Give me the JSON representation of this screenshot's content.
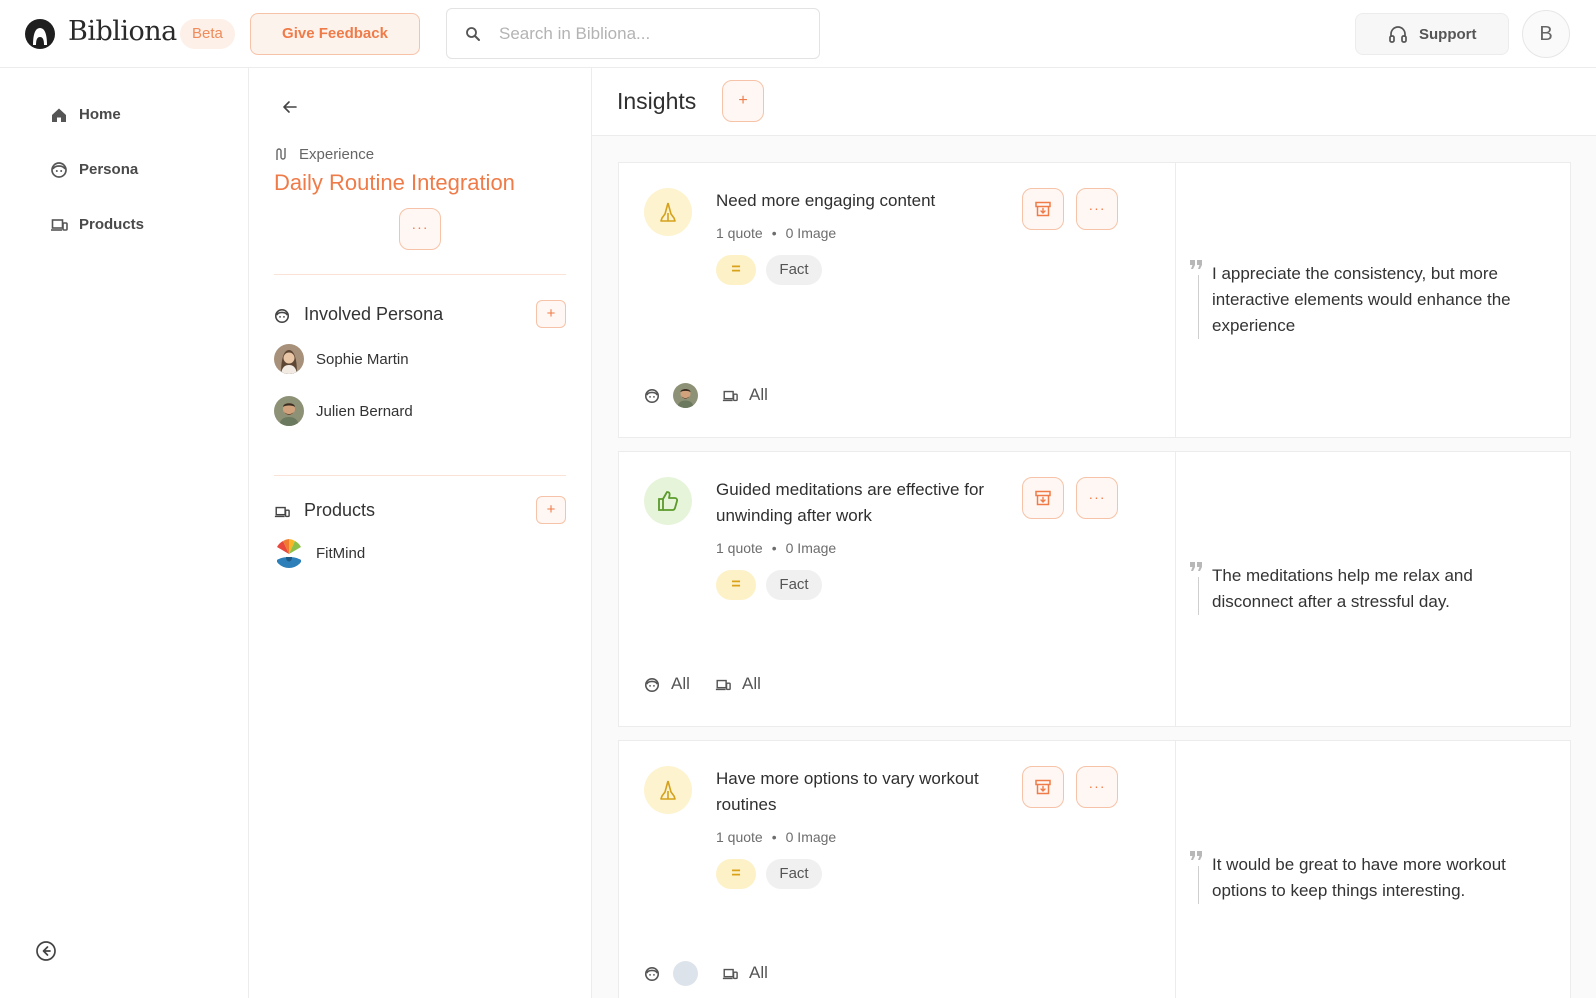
{
  "app": {
    "name": "Bibliona",
    "beta_label": "Beta",
    "feedback_label": "Give Feedback",
    "search_placeholder": "Search in Bibliona...",
    "support_label": "Support",
    "user_initial": "B"
  },
  "nav": {
    "items": [
      {
        "label": "Home",
        "icon": "home-icon"
      },
      {
        "label": "Persona",
        "icon": "persona-icon"
      },
      {
        "label": "Products",
        "icon": "devices-icon"
      }
    ]
  },
  "experience": {
    "type_label": "Experience",
    "title": "Daily Routine Integration",
    "more_label": "···",
    "involved_persona": {
      "heading": "Involved Persona",
      "add_label": "+",
      "people": [
        {
          "name": "Sophie Martin"
        },
        {
          "name": "Julien Bernard"
        }
      ]
    },
    "products": {
      "heading": "Products",
      "add_label": "+",
      "items": [
        {
          "name": "FitMind"
        }
      ]
    }
  },
  "insights": {
    "title": "Insights",
    "add_label": "+",
    "cards": [
      {
        "kind": "need",
        "kind_color": "#fdf3cf",
        "title": "Need more engaging content",
        "quotes": "1 quote",
        "images": "0 Image",
        "sentiment": "=",
        "tag": "Fact",
        "persona_text": "",
        "product_text": "All",
        "quote": "I appreciate the consistency, but more interactive elements would enhance the experience"
      },
      {
        "kind": "positive",
        "kind_color": "#e6f4da",
        "title": "Guided meditations are effective for unwinding after work",
        "quotes": "1 quote",
        "images": "0 Image",
        "sentiment": "=",
        "tag": "Fact",
        "persona_text": "All",
        "product_text": "All",
        "quote": "The meditations help me relax and disconnect after a stressful day."
      },
      {
        "kind": "need",
        "kind_color": "#fdf3cf",
        "title": "Have more options to vary workout routines",
        "quotes": "1 quote",
        "images": "0 Image",
        "sentiment": "=",
        "tag": "Fact",
        "persona_text": "",
        "product_text": "All",
        "quote": "It would be great to have more workout options to keep things interesting."
      }
    ],
    "more_label": "···"
  }
}
